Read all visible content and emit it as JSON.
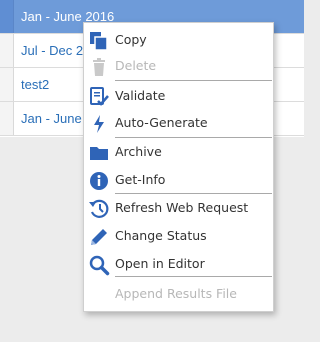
{
  "list": {
    "rows": [
      {
        "text": "Jan - June 2016"
      },
      {
        "text": "Jul - Dec 2"
      },
      {
        "text": "test2"
      },
      {
        "text": "Jan - June"
      }
    ]
  },
  "context_menu": {
    "items": [
      {
        "label": "Copy",
        "icon": "copy-icon",
        "enabled": true
      },
      {
        "label": "Delete",
        "icon": "trash-icon",
        "enabled": false
      },
      {
        "label": "Validate",
        "icon": "validate-icon",
        "enabled": true
      },
      {
        "label": "Auto-Generate",
        "icon": "lightning-icon",
        "enabled": true
      },
      {
        "label": "Archive",
        "icon": "folder-icon",
        "enabled": true
      },
      {
        "label": "Get-Info",
        "icon": "info-icon",
        "enabled": true
      },
      {
        "label": "Refresh Web Request",
        "icon": "history-icon",
        "enabled": true
      },
      {
        "label": "Change Status",
        "icon": "pencil-icon",
        "enabled": true
      },
      {
        "label": "Open in Editor",
        "icon": "magnifier-icon",
        "enabled": true
      },
      {
        "label": "Append Results File",
        "icon": "",
        "enabled": false
      }
    ]
  },
  "colors": {
    "selection": "#6e9bd9",
    "icon_blue": "#2f64b7",
    "disabled": "#b7b7b7"
  }
}
